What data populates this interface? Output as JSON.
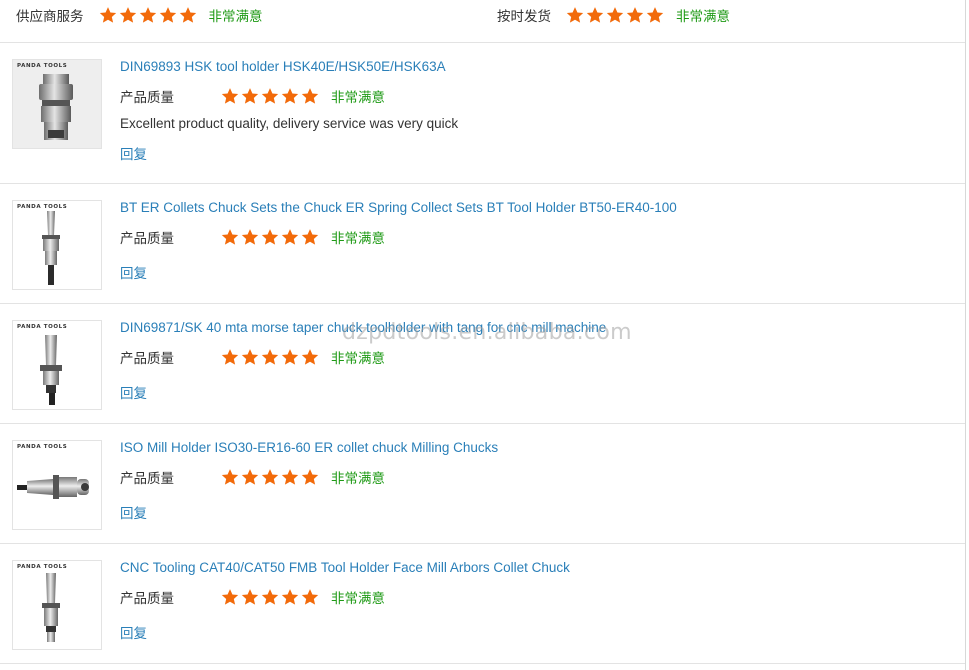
{
  "summary": {
    "supplier_label": "供应商服务",
    "supplier_rating": 5,
    "supplier_status": "非常满意",
    "shipping_label": "按时发货",
    "shipping_rating": 5,
    "shipping_status": "非常满意"
  },
  "colors": {
    "star": "#f26a0a",
    "link": "#2a7fb8",
    "status": "#1f9a16"
  },
  "reviews": [
    {
      "brand": "PANDA TOOLS",
      "title": "DIN69893 HSK tool holder HSK40E/HSK50E/HSK63A",
      "quality_label": "产品质量",
      "rating": 5,
      "status": "非常满意",
      "comment": "Excellent product quality, delivery service was very quick",
      "reply": "回复"
    },
    {
      "brand": "PANDA TOOLS",
      "title": "BT ER Collets Chuck Sets the Chuck ER Spring Collect Sets BT Tool Holder BT50-ER40-100",
      "quality_label": "产品质量",
      "rating": 5,
      "status": "非常满意",
      "reply": "回复"
    },
    {
      "brand": "PANDA TOOLS",
      "title": "DIN69871/SK 40 mta morse taper chuck toolholder with tang for cnc mill machine",
      "quality_label": "产品质量",
      "rating": 5,
      "status": "非常满意",
      "reply": "回复"
    },
    {
      "brand": "PANDA TOOLS",
      "title": "ISO Mill Holder ISO30-ER16-60 ER collet chuck Milling Chucks",
      "quality_label": "产品质量",
      "rating": 5,
      "status": "非常满意",
      "reply": "回复"
    },
    {
      "brand": "PANDA TOOLS",
      "title": "CNC Tooling CAT40/CAT50 FMB Tool Holder Face Mill Arbors Collet Chuck",
      "quality_label": "产品质量",
      "rating": 5,
      "status": "非常满意",
      "reply": "回复"
    }
  ],
  "watermark": "dzpdtools.en.alibaba.com"
}
